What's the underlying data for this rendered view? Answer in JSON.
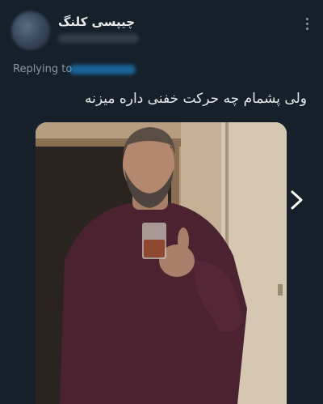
{
  "tweet": {
    "display_name": "چیپسی کلنگ",
    "replying_to_label": "Replying to",
    "text": "ولی پشمام چه حرکت خفنی داره میزنه"
  },
  "icons": {
    "more": "more-vertical-icon",
    "next": "chevron-right-icon"
  },
  "colors": {
    "background": "#15202b",
    "text": "#e7e9ea",
    "muted": "#8b98a5",
    "link": "#1d9bf0"
  }
}
